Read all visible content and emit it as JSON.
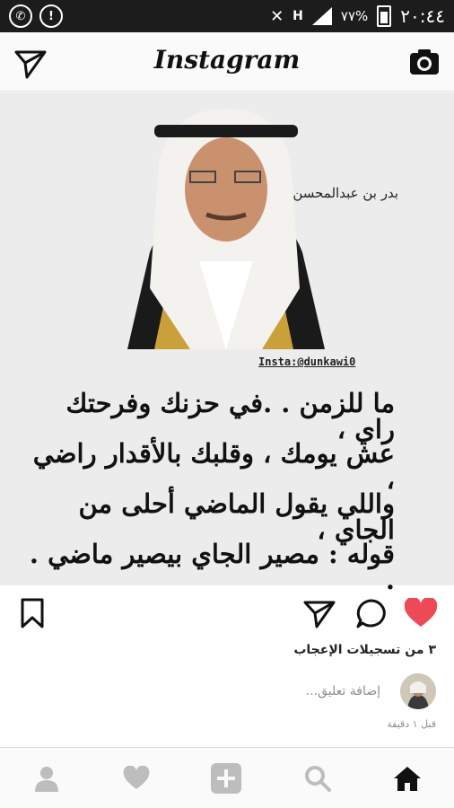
{
  "status_bar": {
    "time": "٢٠:٤٤",
    "battery": "٧٧%",
    "network": "H"
  },
  "header": {
    "title": "Instagram",
    "left_icon": "direct-send-icon",
    "right_icon": "camera-icon"
  },
  "post": {
    "name_label": "بدر بن عبدالمحسن",
    "handle": "Insta:@dunkawi0",
    "poem_lines": [
      "ما للزمن . .في حزنك وفرحتك راي ،",
      "عش يومك ، وقلبك بالأقدار راضي ،",
      "واللي يقول الماضي أحلى من الجاي ،",
      "قوله : مصير الجاي بيصير ماضي . ."
    ]
  },
  "actions": {
    "likes_text": "٣ من تسجيلات الإعجاب",
    "comment_placeholder": "إضافة تعليق...",
    "timestamp": "قبل ١ دقيقة"
  },
  "colors": {
    "like_red": "#ed4956",
    "status_bar_bg": "#1c1c1c",
    "nav_icon_grey": "#bdbdbd"
  },
  "bottom_nav": [
    "profile-icon",
    "heart-icon",
    "add-icon",
    "search-icon",
    "home-icon"
  ]
}
